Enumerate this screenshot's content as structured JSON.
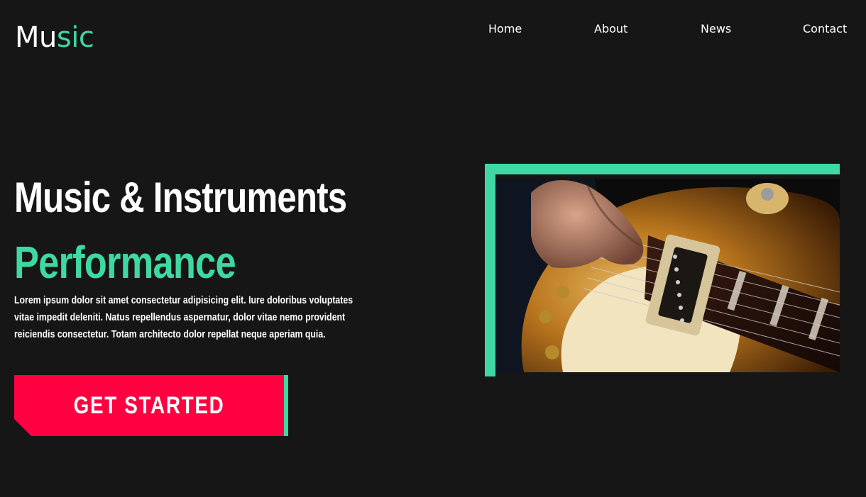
{
  "logo": {
    "part1": "Mu",
    "part2": "sic"
  },
  "nav": {
    "home": "Home",
    "about": "About",
    "news": "News",
    "contact": "Contact"
  },
  "hero": {
    "title": "Music & Instruments",
    "subtitle": "Performance",
    "description": "Lorem ipsum dolor sit amet consectetur adipisicing elit. Iure doloribus voluptates vitae impedit deleniti. Natus repellendus aspernatur, dolor vitae nemo provident reiciendis consectetur. Totam architecto dolor repellat neque aperiam quia.",
    "cta_label": "GET STARTED"
  },
  "colors": {
    "accent": "#3ed9a3",
    "cta": "#ff0040",
    "background": "#171616"
  }
}
